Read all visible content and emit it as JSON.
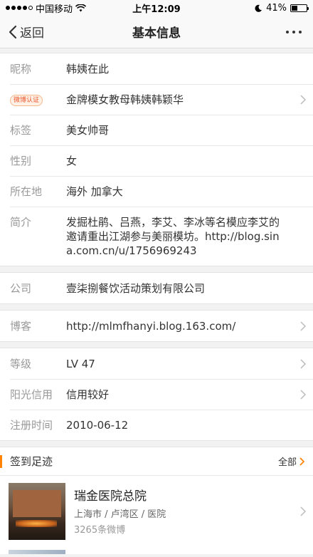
{
  "status_bar": {
    "carrier": "中国移动",
    "time": "上午12:09",
    "battery": "41%",
    "battery_level": 0.41
  },
  "nav": {
    "back_label": "返回",
    "title": "基本信息"
  },
  "profile": {
    "nickname": {
      "label": "昵称",
      "value": "韩姨在此"
    },
    "verify": {
      "badge": "微博认证",
      "value": "金牌模女教母韩姨韩颖华"
    },
    "tags": {
      "label": "标签",
      "value": "美女帅哥"
    },
    "gender": {
      "label": "性别",
      "value": "女"
    },
    "location": {
      "label": "所在地",
      "value": "海外 加拿大"
    },
    "bio": {
      "label": "简介",
      "value": "发掘杜鹃、吕燕，李艾、李冰等名模应李艾的邀请重出江湖参与美丽模坊。http://blog.sina.com.cn/u/1756969243"
    }
  },
  "company": {
    "label": "公司",
    "value": "壹柒捌餐饮活动策划有限公司"
  },
  "blog": {
    "label": "博客",
    "value": "http://mlmfhanyi.blog.163.com/"
  },
  "account": {
    "level": {
      "label": "等级",
      "value": "LV 47"
    },
    "credit": {
      "label": "阳光信用",
      "value": "信用较好"
    },
    "register": {
      "label": "注册时间",
      "value": "2010-06-12"
    }
  },
  "footprints": {
    "title": "签到足迹",
    "all_label": "全部",
    "items": [
      {
        "name": "瑞金医院总院",
        "location": "上海市 / 卢湾区 / 医院",
        "count": "3265条微博"
      }
    ]
  },
  "colors": {
    "accent": "#ff8200",
    "badge": "#e8572b"
  }
}
